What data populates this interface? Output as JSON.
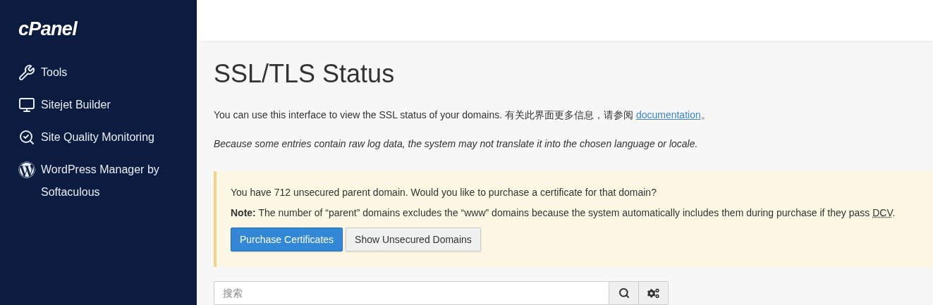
{
  "sidebar": {
    "logo": "cPanel",
    "items": [
      {
        "kind": "tools",
        "label": "Tools"
      },
      {
        "kind": "builder",
        "label": "Sitejet Builder"
      },
      {
        "kind": "monitoring",
        "label": "Site Quality Monitoring"
      },
      {
        "kind": "wordpress",
        "label": "WordPress Manager by Softaculous"
      }
    ]
  },
  "page": {
    "title": "SSL/TLS Status",
    "intro": {
      "text": "You can use this interface to view the SSL status of your domains. 有关此界面更多信息，请参阅 ",
      "link": "documentation",
      "suffix": "。"
    },
    "notice": "Because some entries contain raw log data, the system may not translate it into the chosen language or locale.",
    "alert": {
      "message": "You have 712 unsecured parent domain. Would you like to purchase a certificate for that domain?",
      "note": "**Note:** The number of “parent” domains excludes the “www” domains because the system automatically includes them during purchase if they pass ",
      "abbr": "DCV",
      "note_suffix": ".",
      "buttons": [
        {
          "kind": "primary",
          "label": "Purchase Certificates"
        },
        {
          "kind": "default",
          "label": "Show Unsecured Domains"
        }
      ]
    },
    "search": {
      "placeholder": "搜索"
    }
  }
}
